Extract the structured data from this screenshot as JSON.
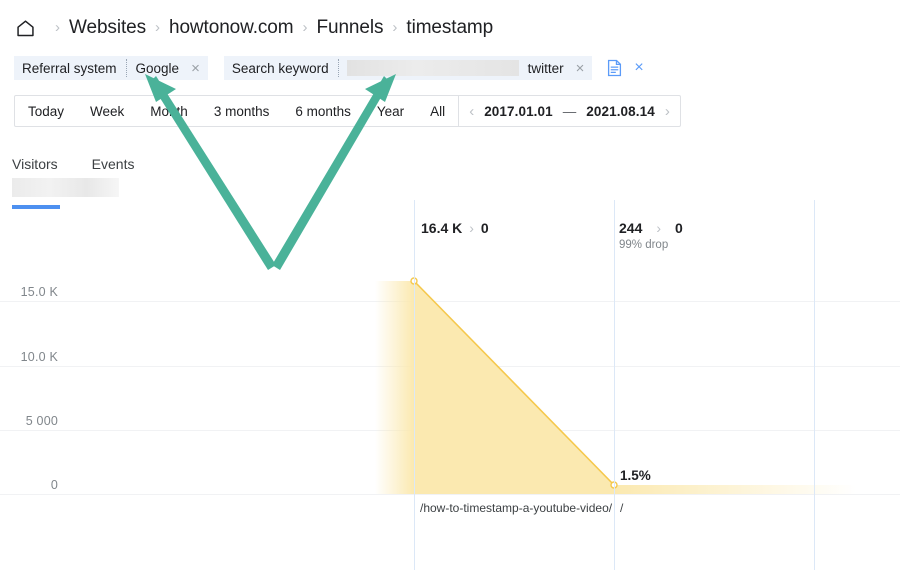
{
  "breadcrumb": {
    "home_icon": "home-icon",
    "separator": "›",
    "items": [
      {
        "label": "Websites"
      },
      {
        "label": "howtonow.com"
      },
      {
        "label": "Funnels"
      },
      {
        "label": "timestamp"
      }
    ]
  },
  "filters": {
    "chips": [
      {
        "key": "Referral system",
        "value": "Google",
        "remove": "×"
      },
      {
        "key": "Search keyword",
        "value": "twitter",
        "value_redacted": true,
        "remove": "×"
      }
    ],
    "save_icon": "save-document-icon",
    "close_icon": "×"
  },
  "date_range": {
    "presets": [
      "Today",
      "Week",
      "Month",
      "3 months",
      "6 months",
      "Year",
      "All"
    ],
    "prev_arrow": "‹",
    "next_arrow": "›",
    "start": "2017.01.01",
    "dash": "—",
    "end": "2021.08.14"
  },
  "metric_tabs": {
    "items": [
      "Visitors",
      "Events"
    ],
    "active": "Visitors",
    "value_redacted": true,
    "accent": "#4d90f0"
  },
  "annotations": {
    "color": "#4ab299",
    "arrows": [
      {
        "name": "arrow-to-google-chip",
        "target": "Google"
      },
      {
        "name": "arrow-to-search-keyword-value",
        "target": "Search keyword"
      }
    ]
  },
  "chart_data": {
    "type": "area",
    "title": "",
    "xlabel": "",
    "ylabel": "",
    "ylim": [
      0,
      16400
    ],
    "yticks": [
      0,
      5000,
      10000,
      15000
    ],
    "ytick_labels": [
      "0",
      "5 000",
      "10.0 K",
      "15.0 K"
    ],
    "grid": true,
    "legend": null,
    "series_color": "#f5c84c",
    "fill_color": "#fbe9b0",
    "steps": [
      {
        "url": "/how-to-timestamp-a-youtube-video/",
        "visitors_label": "16.4 K",
        "visitors": 16400,
        "chevron": "›",
        "next_label": "0",
        "next": 0,
        "drop": null,
        "pct": null
      },
      {
        "url": "/",
        "visitors_label": "244",
        "visitors": 244,
        "chevron": "›",
        "next_label": "0",
        "next": 0,
        "drop": "99% drop",
        "pct": "1.5%"
      }
    ]
  }
}
